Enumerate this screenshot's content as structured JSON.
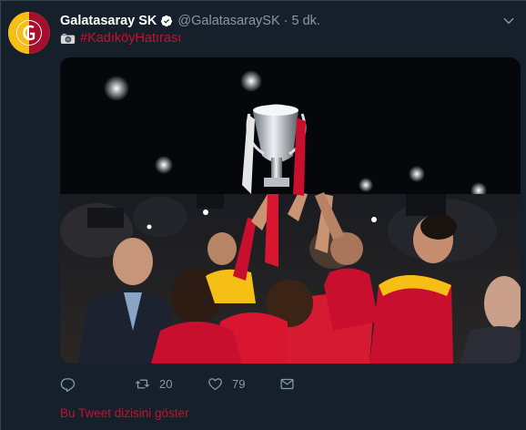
{
  "tweet": {
    "display_name": "Galatasaray SK",
    "handle": "@GalatasaraySK",
    "separator": "·",
    "time_ago": "5 dk.",
    "hashtag": "#KadıköyHatırası",
    "camera_icon": "camera-emoji",
    "verified_icon": "verified-badge-icon",
    "menu_icon": "chevron-down-icon",
    "photo_description_icon": "trophy-celebration-photo"
  },
  "actions": {
    "reply_icon": "reply-icon",
    "reply_count": "",
    "retweet_icon": "retweet-icon",
    "retweet_count": "20",
    "like_icon": "heart-icon",
    "like_count": "79",
    "dm_icon": "envelope-icon"
  },
  "thread_link": "Bu Tweet dizisini göster",
  "colors": {
    "background": "#15202b",
    "secondary_text": "#8899a6",
    "accent_red": "#c8102e",
    "club_yellow": "#f6bf16",
    "verified_blue": "#1da1f2"
  }
}
